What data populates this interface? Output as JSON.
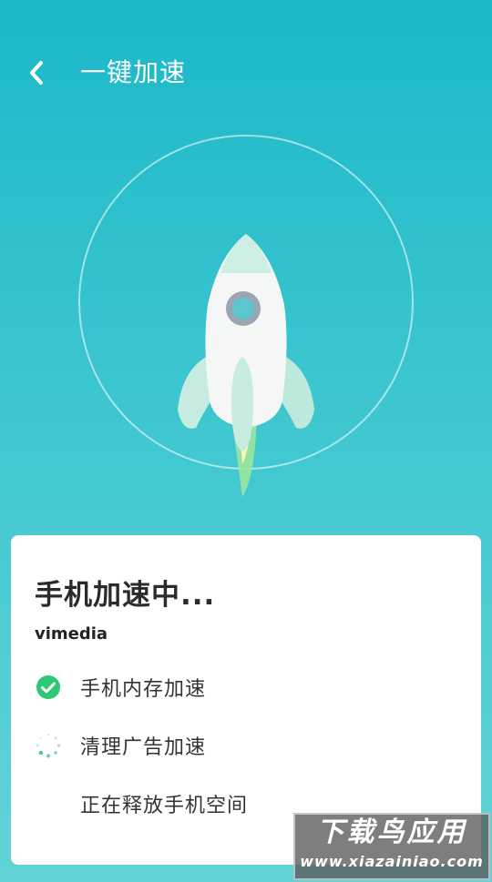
{
  "header": {
    "title": "一键加速"
  },
  "status": {
    "title": "手机加速中...",
    "brand": "vimedia"
  },
  "tasks": [
    {
      "label": "手机内存加速",
      "state": "done",
      "icon": "check-circle-icon"
    },
    {
      "label": "清理广告加速",
      "state": "loading",
      "icon": "spinner-icon"
    },
    {
      "label": "正在释放手机空间",
      "state": "pending",
      "icon": ""
    }
  ],
  "watermark": {
    "line1": "下载鸟应用",
    "line2": "www.xiazainiao.com"
  },
  "colors": {
    "gradient_top": "#1bb8c9",
    "gradient_bottom": "#62d3d6",
    "success": "#2fc774"
  }
}
